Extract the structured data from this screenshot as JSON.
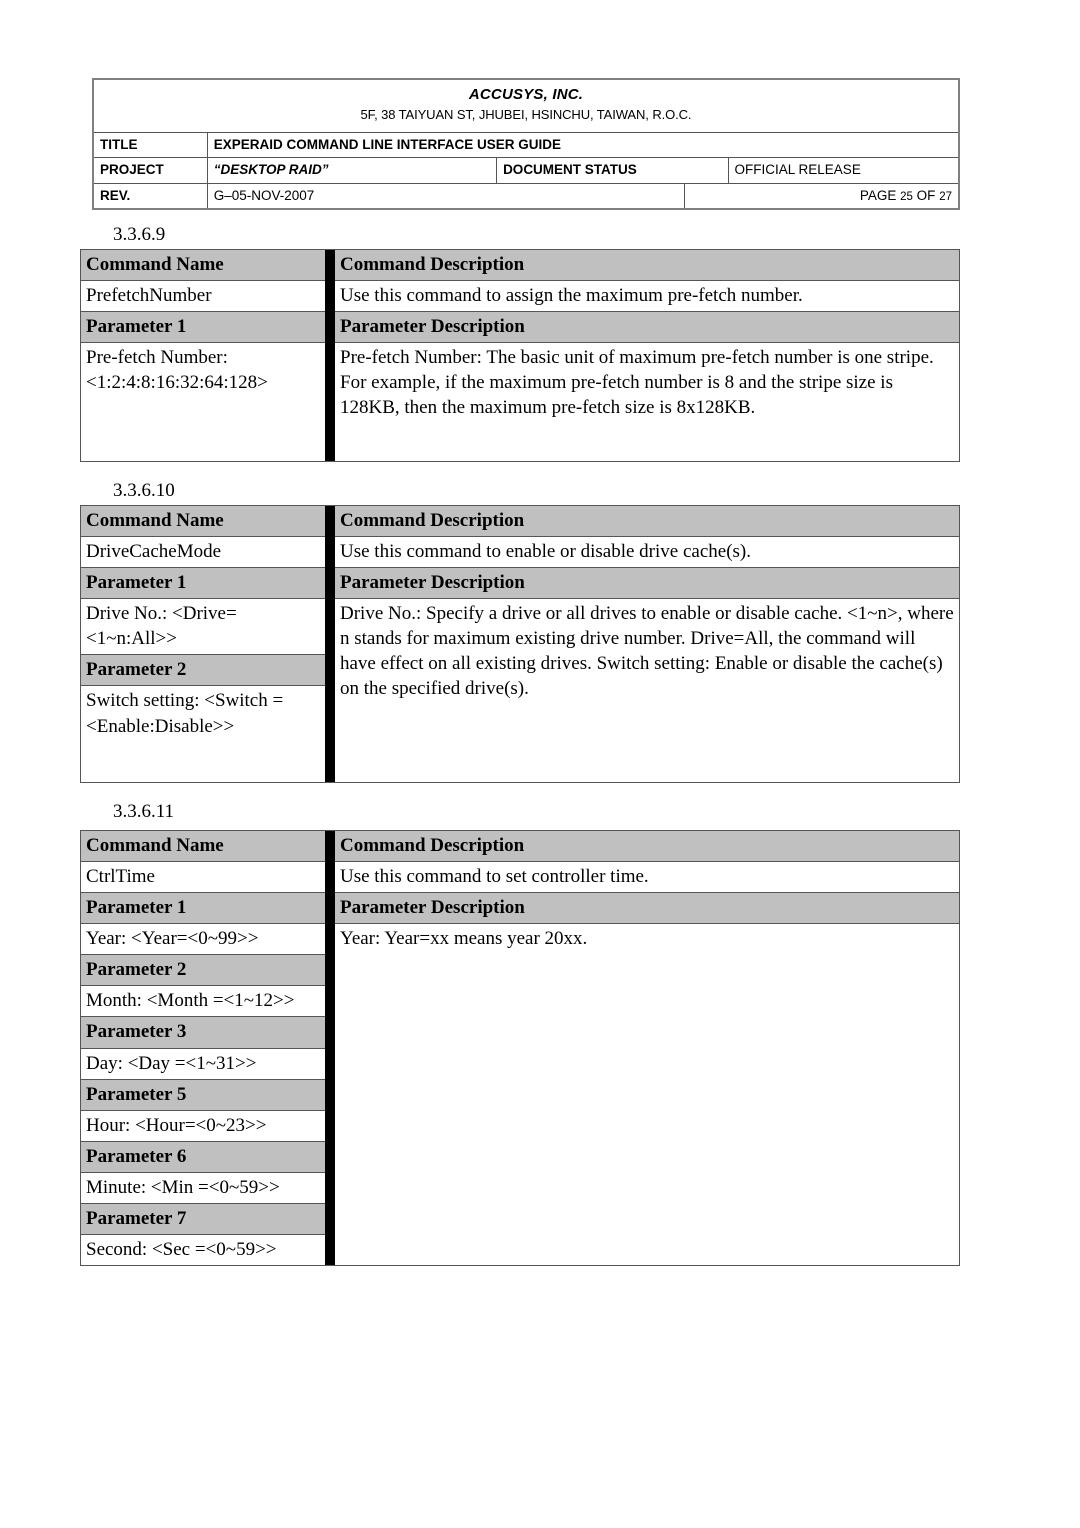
{
  "header": {
    "company_name": "ACCUSYS, INC.",
    "company_address": "5F, 38 TAIYUAN ST, JHUBEI, HSINCHU, TAIWAN, R.O.C.",
    "title_label": "TITLE",
    "title_value": "EXPERAID COMMAND LINE INTERFACE USER GUIDE",
    "project_label": "PROJECT",
    "project_value": "“DESKTOP RAID”",
    "doc_status_label": "DOCUMENT  STATUS",
    "doc_status_value": "OFFICIAL RELEASE",
    "rev_label": "REV.",
    "rev_value": "G–05-NOV-2007",
    "page_prefix": "PAGE",
    "page_current": "25",
    "page_of": "OF",
    "page_total": "27"
  },
  "column_headers": {
    "command_name": "Command Name",
    "command_description": "Command Description",
    "parameter_description": "Parameter Description"
  },
  "sections": [
    {
      "number": "3.3.6.9",
      "command_name": "PrefetchNumber",
      "command_description": "Use this command to assign the maximum pre-fetch number.",
      "parameters": [
        {
          "label": "Parameter 1",
          "lines": [
            "Pre-fetch Number:",
            "<1:2:4:8:16:32:64:128>"
          ]
        }
      ],
      "description_lines": [
        "Pre-fetch Number:",
        "The basic unit of maximum pre-fetch number is one stripe. For example, if the maximum pre-fetch number is 8 and the stripe size is 128KB, then the maximum pre-fetch size is 8x128KB."
      ]
    },
    {
      "number": "3.3.6.10",
      "command_name": "DriveCacheMode",
      "command_description": "Use this command to enable or disable drive cache(s).",
      "parameters": [
        {
          "label": "Parameter 1",
          "lines": [
            "Drive No.:",
            "<Drive=<1~n:All>>"
          ]
        },
        {
          "label": "Parameter 2",
          "lines": [
            "Switch setting:",
            "<Switch",
            "=<Enable:Disable>>"
          ]
        }
      ],
      "description_lines": [
        "Drive No.:",
        "Specify a drive or all drives to enable or disable cache.",
        "<1~n>, where n stands for maximum existing drive number.",
        "Drive=All, the command will have effect on all existing drives.",
        "",
        "Switch setting:",
        "Enable or disable the cache(s) on the specified drive(s)."
      ]
    },
    {
      "number": "3.3.6.11",
      "command_name": "CtrlTime",
      "command_description": "Use this command to set controller time.",
      "parameters": [
        {
          "label": "Parameter 1",
          "lines": [
            "Year:",
            "<Year=<0~99>>"
          ]
        },
        {
          "label": "Parameter 2",
          "lines": [
            "Month:",
            "<Month =<1~12>>"
          ]
        },
        {
          "label": "Parameter 3",
          "lines": [
            "Day:",
            "<Day =<1~31>>"
          ]
        },
        {
          "label": "Parameter 5",
          "lines": [
            "Hour:",
            "<Hour=<0~23>>"
          ]
        },
        {
          "label": "Parameter 6",
          "lines": [
            "Minute:",
            "<Min =<0~59>>"
          ]
        },
        {
          "label": "Parameter 7",
          "lines": [
            "Second:",
            "<Sec =<0~59>>"
          ]
        }
      ],
      "description_lines": [
        "Year:",
        "Year=xx means year 20xx."
      ]
    }
  ],
  "colors": {
    "shade": "#c0c0c0",
    "border": "#555555",
    "divider": "#000000"
  }
}
